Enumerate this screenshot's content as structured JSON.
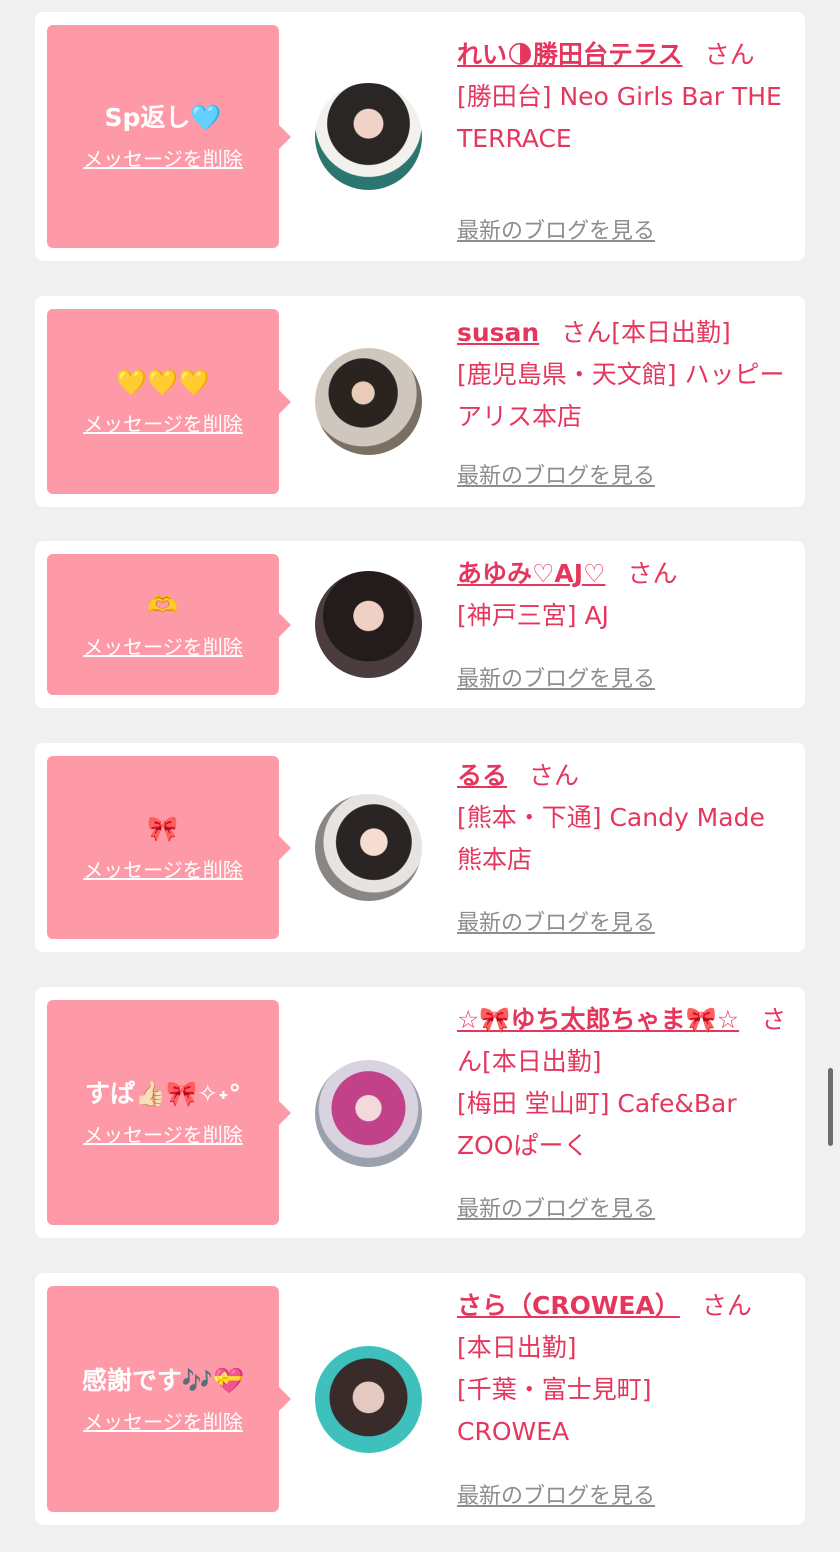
{
  "delete_label": "メッセージを削除",
  "blog_label": "最新のブログを見る",
  "san_label": "さん",
  "cards": [
    {
      "message": "Sp返し🩵",
      "name": "れい🌗勝田台テラス",
      "name_suffix": "",
      "shop": "[勝田台] Neo Girls Bar THE TERRACE"
    },
    {
      "message": "💛💛💛",
      "name": "susan",
      "name_suffix": "[本日出勤]",
      "shop": "[鹿児島県・天文館] ハッピーアリス本店"
    },
    {
      "message": "🫶",
      "name": "あゆみ♡AJ♡",
      "name_suffix": "",
      "shop": "[神戸三宮] AJ"
    },
    {
      "message": "🎀",
      "name": "るる",
      "name_suffix": "",
      "shop": "[熊本・下通] Candy Made 熊本店"
    },
    {
      "message": "すぱ👍🏻🎀✧˖°",
      "name": "☆🎀ゆち太郎ちゃま🎀☆",
      "name_suffix": "[本日出勤]",
      "shop": "[梅田 堂山町] Cafe&Bar ZOOぱーく"
    },
    {
      "message": "感謝です🎶💝",
      "name": "さら（CROWEA）",
      "name_suffix": "",
      "status_line": "[本日出勤]",
      "shop": "[千葉・富士見町] CROWEA"
    }
  ],
  "colors": {
    "accent": "#e5375e",
    "bubble": "#fe9aa7",
    "background": "#f0f0f0",
    "link_gray": "#8d8d8d"
  }
}
